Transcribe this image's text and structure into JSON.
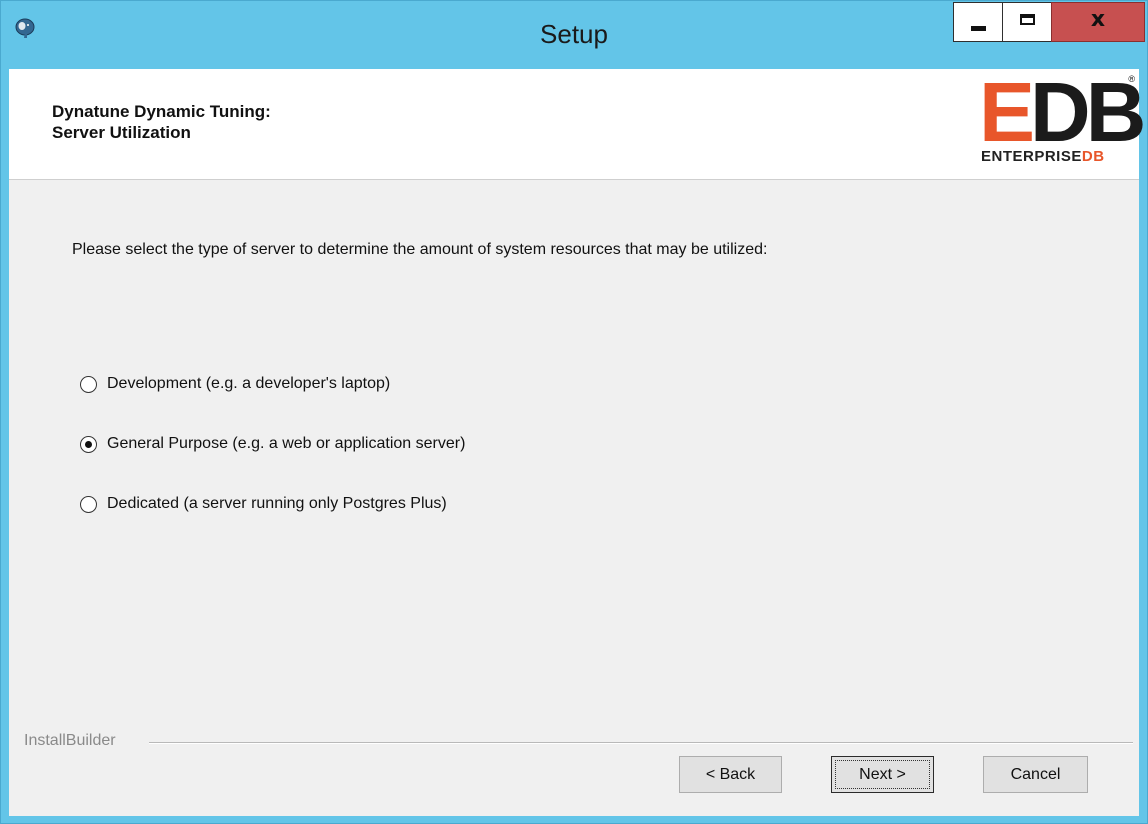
{
  "window": {
    "title": "Setup",
    "controls": {
      "minimize": "minimize",
      "maximize": "maximize",
      "close": "x"
    }
  },
  "header": {
    "title_line1": "Dynatune Dynamic Tuning:",
    "title_line2": "Server Utilization",
    "logo": {
      "mark_e": "E",
      "mark_db": "DB",
      "registered": "®",
      "sub_main": "ENTERPRISE",
      "sub_accent": "DB",
      "accent_color": "#e8562a"
    }
  },
  "content": {
    "instructions": "Please select the type of server to determine the amount of system resources that may be utilized:",
    "options": [
      {
        "label": "Development (e.g. a developer's laptop)",
        "selected": false
      },
      {
        "label": "General Purpose (e.g. a web or application server)",
        "selected": true
      },
      {
        "label": "Dedicated (a server running only Postgres Plus)",
        "selected": false
      }
    ]
  },
  "footer": {
    "brand": "InstallBuilder",
    "back": "< Back",
    "next": "Next >",
    "cancel": "Cancel"
  },
  "colors": {
    "titlebar": "#63c5e8",
    "close_button": "#c75050",
    "content_bg": "#f0f0f0"
  }
}
